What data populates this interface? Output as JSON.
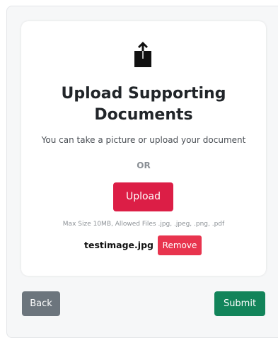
{
  "upload_card": {
    "icon": "share-upload-icon",
    "title": "Upload Supporting Documents",
    "subtitle": "You can take a picture or upload your document",
    "separator": "OR",
    "upload_label": "Upload",
    "hint": "Max Size 10MB, Allowed Files .jpg, .jpeg, .png, .pdf",
    "file": {
      "name": "testimage.jpg",
      "remove_label": "Remove"
    }
  },
  "footer": {
    "back_label": "Back",
    "submit_label": "Submit"
  },
  "colors": {
    "upload_button": "#dc1e46",
    "remove_button": "#e8344e",
    "back_button": "#6c757d",
    "submit_button": "#12845a"
  }
}
